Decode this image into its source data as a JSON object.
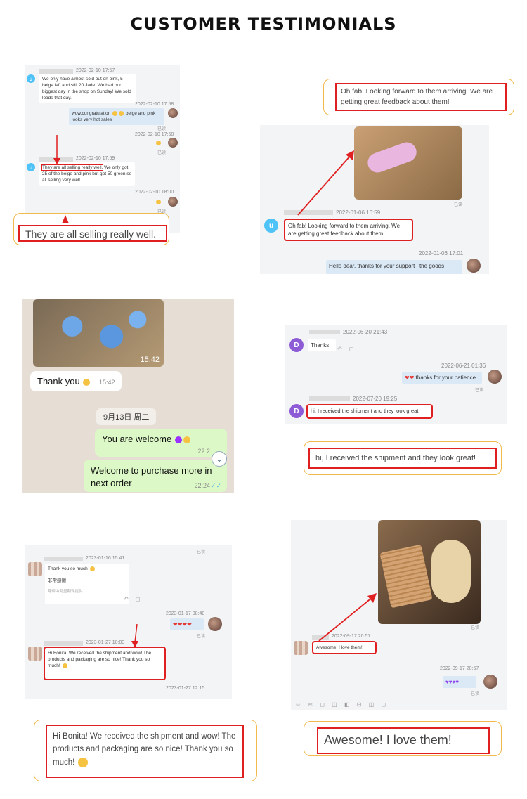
{
  "page": {
    "title": "CUSTOMER TESTIMONIALS"
  },
  "panel1": {
    "msg1_time": "2022-02-10 17:57",
    "msg1_text": "We only have almost sold out on pink, 5 beige left and still 20 Jade. We had our biggest day in the shop on Sunday! We sold loads that day.",
    "msg2_time": "2022-02-10 17:58",
    "msg2_text_a": "wow,congratulation",
    "msg2_text_b": "beige and pink looks very hot sales",
    "read1": "已读",
    "msg3_time": "2022-02-10 17:58",
    "read2": "已读",
    "msg4_time": "2022-02-10 17:59",
    "msg4_highlight": "They are all selling really well.",
    "msg4_rest": "We only got 25 of the beige and pink but got 50 green so all selling very well.",
    "msg5_time": "2022-02-10 18:00",
    "read3": "已读",
    "callout": "They are all selling really well."
  },
  "panel2": {
    "callout": "Oh fab! Looking forward to them arriving. We are getting great feedback about them!",
    "read": "已读",
    "msg_time": "2022-01-06 16:59",
    "msg_text": "Oh fab! Looking forward to them arriving. We are getting great feedback about them!",
    "reply_time": "2022-01-06 17:01",
    "reply_text": "Hello dear, thanks for your support , the goods"
  },
  "panel3": {
    "photo_time": "15:42",
    "thanks_text": "Thank you",
    "thanks_time": "15:42",
    "date_chip": "9月13日 周二",
    "welcome_text": "You are welcome",
    "welcome_time": "22:2",
    "purchase_text": "Welcome to purchase more in next order",
    "purchase_time": "22:24"
  },
  "panel4": {
    "msg1_time": "2022-06-20 21:43",
    "msg1_text": "Thanks",
    "msg2_time": "2022-06-21 01:36",
    "msg2_text": "thanks for your patience",
    "read": "已读",
    "msg3_time": "2022-07-20 19:25",
    "msg3_text": "hi, I received the shipment and they look great!",
    "callout": "hi, I received the shipment and they look great!",
    "avatar_letter": "D"
  },
  "panel5": {
    "read_top": "已读",
    "msg1_time": "2023-01-16 15:41",
    "msg1_text": "Thank you so much",
    "msg1_sub": "非常感谢",
    "msg1_note": "翻译由阿里翻译提供",
    "msg2_time": "2023-01-17 08:48",
    "read2": "已读",
    "msg3_time": "2023-01-27 10:03",
    "msg3_text": "Hi Bonita! We received the shipment and wow! The products and packaging are so nice! Thank you so much!",
    "msg4_time": "2023-01-27 12:15",
    "callout": "Hi Bonita! We received the shipment and wow! The products and packaging are so nice! Thank you so much!"
  },
  "panel6": {
    "read1": "已读",
    "msg_time": "2022-09-17 20:57",
    "msg_text": "Awesome! I love them!",
    "reply_time": "2022-09-17 20:57",
    "read2": "已读",
    "callout": "Awesome! I love them!"
  },
  "colors": {
    "highlight": "#e02020",
    "callout_border": "#f2b94c"
  }
}
